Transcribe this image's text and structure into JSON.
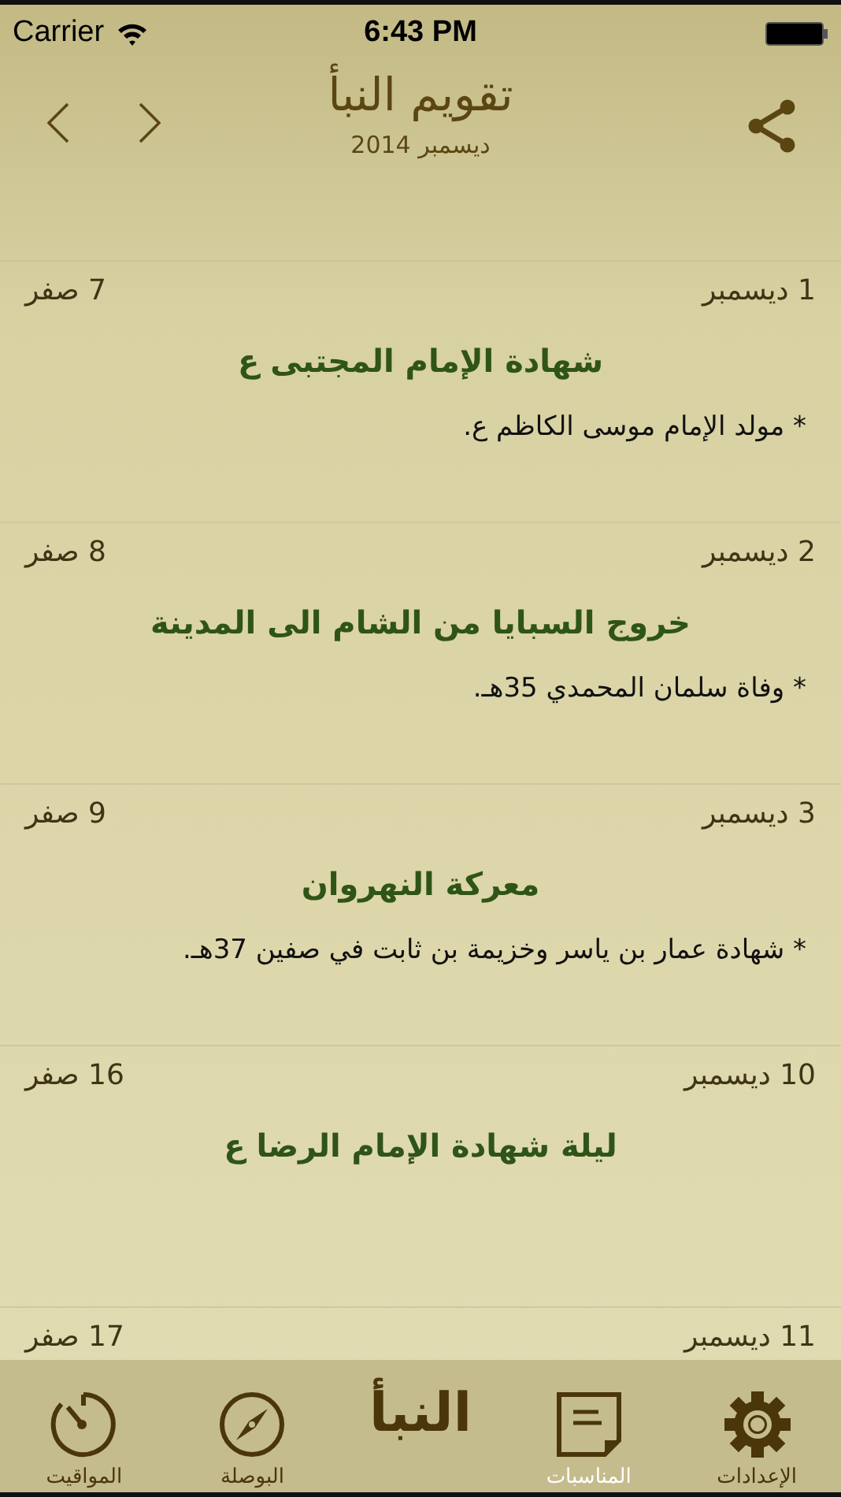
{
  "status_bar": {
    "carrier": "Carrier",
    "time": "6:43 PM"
  },
  "header": {
    "title": "تقويم النبأ",
    "subtitle": "ديسمبر 2014"
  },
  "events": [
    {
      "date": "1 ديسمبر",
      "hijri": "7 صفر",
      "title": "شهادة الإمام المجتبى ع",
      "note": "* مولد الإمام موسى الكاظم ع."
    },
    {
      "date": "2 ديسمبر",
      "hijri": "8 صفر",
      "title": "خروج السبايا من الشام الى المدينة",
      "note": "* وفاة سلمان المحمدي 35هـ."
    },
    {
      "date": "3 ديسمبر",
      "hijri": "9 صفر",
      "title": "معركة النهروان",
      "note": "* شهادة عمار بن ياسر وخزيمة بن ثابت في صفين 37هـ."
    },
    {
      "date": "10 ديسمبر",
      "hijri": "16 صفر",
      "title": "ليلة شهادة الإمام الرضا ع"
    },
    {
      "date": "11 ديسمبر",
      "hijri": "17 صفر"
    }
  ],
  "tabs": [
    {
      "kind": "settings",
      "label": "الإعدادات",
      "selected": false
    },
    {
      "kind": "notes",
      "label": "المناسبات",
      "selected": true
    },
    {
      "kind": "logo",
      "label": "النبأ",
      "selected": false
    },
    {
      "kind": "compass",
      "label": "البوصلة",
      "selected": false
    },
    {
      "kind": "timer",
      "label": "المواقيت",
      "selected": false
    }
  ]
}
